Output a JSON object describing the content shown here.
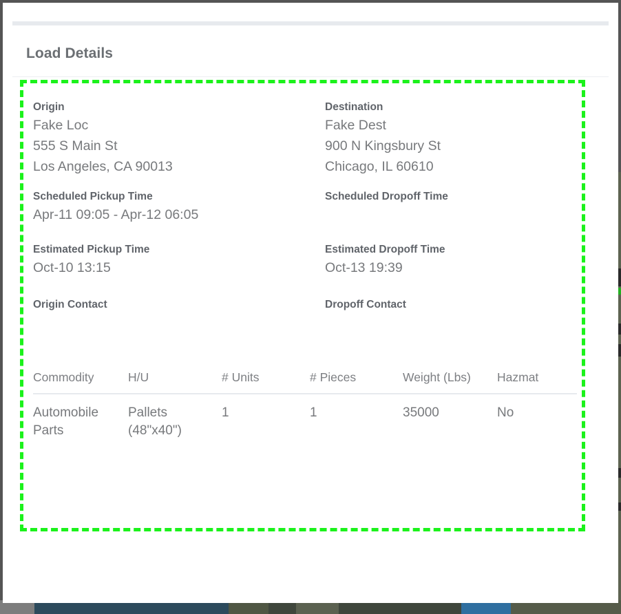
{
  "window": {
    "chrome_color": "#555555",
    "card_background": "#ffffff"
  },
  "header": {
    "title": "Load Details"
  },
  "highlight": {
    "color": "#1bf21b",
    "style": "dashed"
  },
  "details": {
    "origin": {
      "label": "Origin",
      "value": "Fake Loc\n555 S Main St\nLos Angeles, CA 90013"
    },
    "destination": {
      "label": "Destination",
      "value": "Fake Dest\n900 N Kingsbury St\nChicago, IL 60610"
    },
    "scheduled_pickup": {
      "label": "Scheduled Pickup Time",
      "value": "Apr-11 09:05 - Apr-12 06:05"
    },
    "scheduled_dropoff": {
      "label": "Scheduled Dropoff Time",
      "value": ""
    },
    "estimated_pickup": {
      "label": "Estimated Pickup Time",
      "value": "Oct-10 13:15"
    },
    "estimated_dropoff": {
      "label": "Estimated Dropoff Time",
      "value": "Oct-13 19:39"
    },
    "origin_contact": {
      "label": "Origin Contact",
      "value": ""
    },
    "dropoff_contact": {
      "label": "Dropoff Contact",
      "value": ""
    }
  },
  "commodity_table": {
    "columns": [
      "Commodity",
      "H/U",
      "# Units",
      "# Pieces",
      "Weight (Lbs)",
      "Hazmat"
    ],
    "rows": [
      {
        "commodity": "Automobile Parts",
        "hu": "Pallets (48\"x40\")",
        "units": "1",
        "pieces": "1",
        "weight": "35000",
        "hazmat": "No"
      }
    ]
  }
}
